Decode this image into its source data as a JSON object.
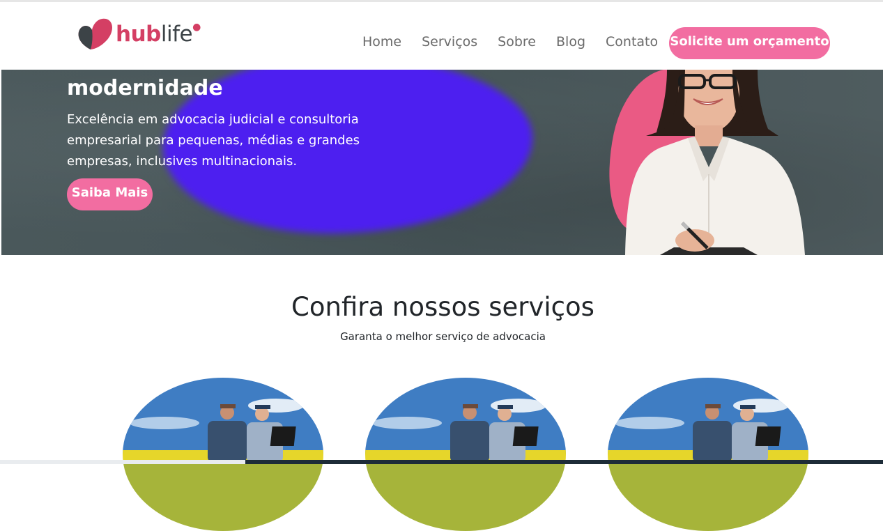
{
  "brand": {
    "part1": "hub",
    "part2": "life",
    "accent": "#d43f64",
    "dark": "#3c4347"
  },
  "nav": {
    "items": [
      "Home",
      "Serviços",
      "Sobre",
      "Blog",
      "Contato"
    ],
    "cta_label": "Solicite um orçamento"
  },
  "hero": {
    "heading": "modernidade",
    "subtitle": "Excelência em advocacia judicial e consultoria empresarial para pequenas, médias e grandes empresas, inclusives multinacionais.",
    "button_label": "Saiba Mais"
  },
  "services": {
    "title": "Confira nossos serviços",
    "subtitle": "Garanta o melhor serviço de advocacia",
    "cards": [
      {
        "image": "farmers-with-laptop"
      },
      {
        "image": "farmers-with-laptop"
      },
      {
        "image": "farmers-with-laptop"
      }
    ]
  },
  "colors": {
    "primary_button": "#f26da1",
    "hero_bg": "#49575a",
    "hero_blob": "#4d1ff0",
    "text": "#212529"
  }
}
